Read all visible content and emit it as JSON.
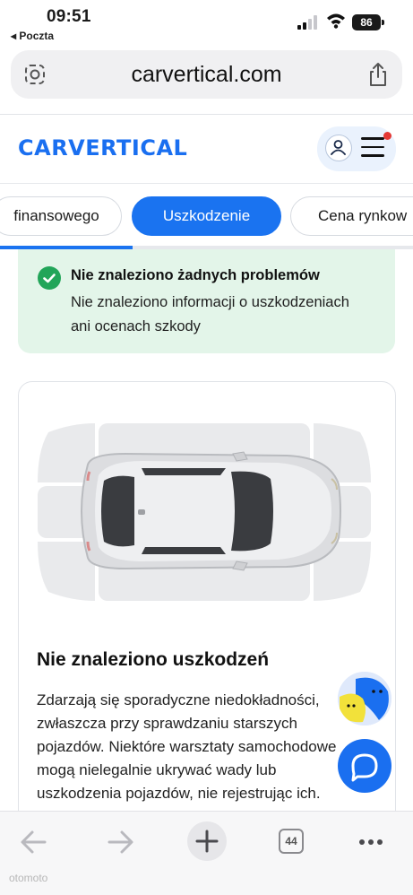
{
  "status_bar": {
    "time": "09:51",
    "back_app": "◂ Poczta",
    "battery": "86"
  },
  "browser": {
    "url": "carvertical.com"
  },
  "header": {
    "logo": "CARVERTICAL"
  },
  "tabs": [
    {
      "label": "finansowego",
      "active": false
    },
    {
      "label": "Uszkodzenie",
      "active": true
    },
    {
      "label": "Cena rynkow",
      "active": false
    }
  ],
  "tabs_scroll_progress": 0.32,
  "success_box": {
    "title": "Nie znaleziono żadnych problemów",
    "description": "Nie znaleziono informacji o uszkodzeniach ani ocenach szkody"
  },
  "damage_card": {
    "title": "Nie znaleziono uszkodzeń",
    "text": "Zdarzają się sporadyczne niedokładności, zwłaszcza przy sprawdzaniu starszych pojazdów. Niektóre warsztaty samochodowe mogą nielegalnie ukrywać wady lub uszkodzenia pojazdów, nie rejestrując ich. Zdarza się, że nawet numery VIN pojazdów"
  },
  "toolbar": {
    "tab_count": "44"
  },
  "watermark": "otomoto",
  "colors": {
    "brand": "#1a6ff0",
    "success_bg": "#e3f5e9",
    "success_icon": "#22a559"
  },
  "icons": [
    "back-arrow-icon",
    "forward-arrow-icon",
    "plus-icon",
    "more-icon",
    "share-icon",
    "site-settings-icon",
    "chat-icon",
    "user-icon",
    "menu-icon"
  ]
}
